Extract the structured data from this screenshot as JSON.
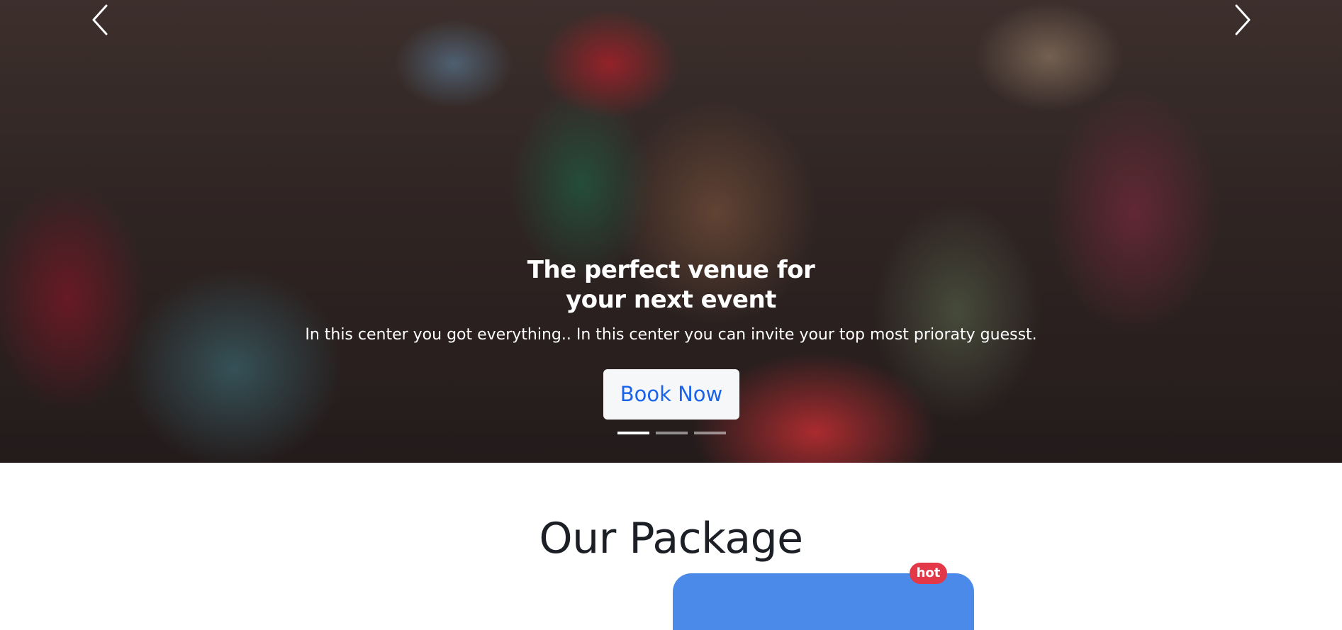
{
  "hero": {
    "title": "The perfect venue for your next event",
    "subtitle": "In this center you got everything.. In this center you can invite your top most prioraty guesst.",
    "cta_label": "Book Now",
    "slides_count": 3,
    "active_slide": 1
  },
  "package_section": {
    "title": "Our Package",
    "badge": "hot"
  },
  "colors": {
    "cta_text": "#1a63ea",
    "card_accent": "#4c8aea",
    "badge_bg": "#e23847",
    "heading_text": "#1c1f25"
  },
  "icons": {
    "prev": "chevron-left-icon",
    "next": "chevron-right-icon"
  }
}
